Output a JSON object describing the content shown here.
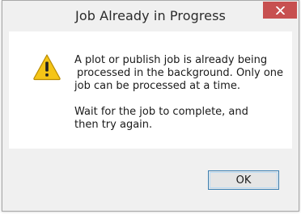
{
  "window": {
    "title": "Job Already in Progress",
    "close_icon": "close-icon"
  },
  "message": {
    "icon": "warning-icon",
    "paragraph1_lines": [
      "A plot or publish job is already being",
      "processed in the background. Only one",
      "job can be processed at a time."
    ],
    "paragraph2_lines": [
      "Wait for the job to complete, and",
      "then try again."
    ]
  },
  "buttons": {
    "ok_label": "OK"
  },
  "colors": {
    "close_button": "#c75050",
    "warning_fill": "#f5c517",
    "button_border": "#3c7fb1"
  }
}
